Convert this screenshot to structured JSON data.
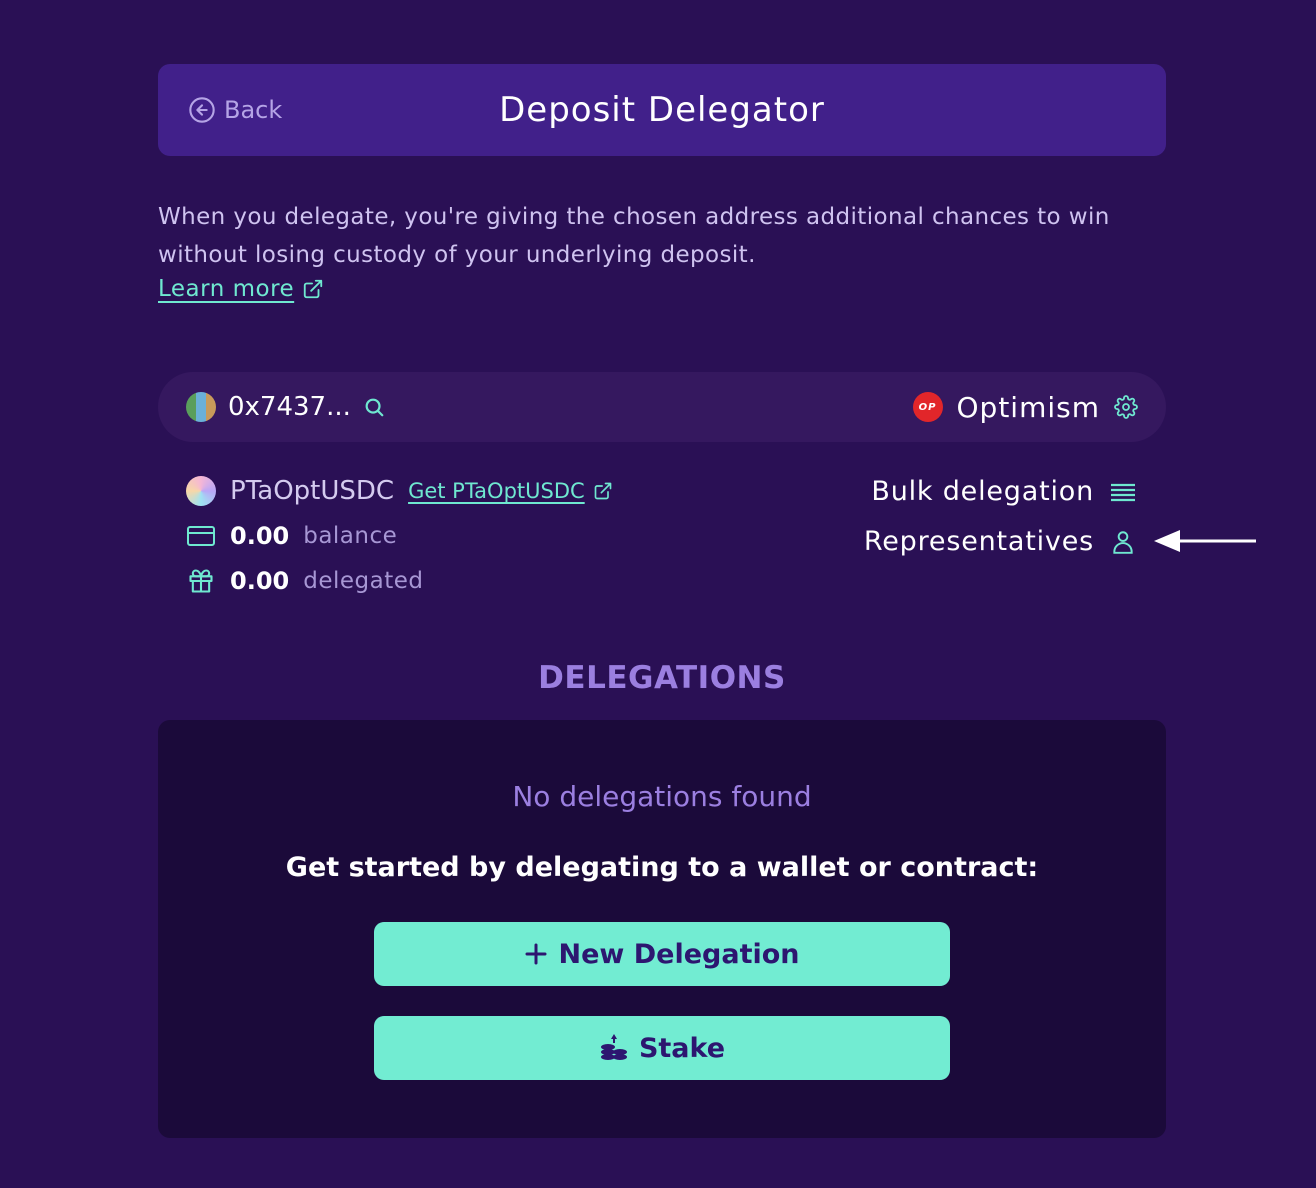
{
  "header": {
    "back_label": "Back",
    "title": "Deposit Delegator"
  },
  "description": {
    "text": "When you delegate, you're giving the chosen address additional chances to win without losing custody of your underlying deposit.",
    "learn_more": "Learn more"
  },
  "selector": {
    "address": "0x7437...",
    "network_badge": "OP",
    "network": "Optimism"
  },
  "token": {
    "name": "PTaOptUSDC",
    "get_link": "Get PTaOptUSDC",
    "balance_value": "0.00",
    "balance_label": "balance",
    "delegated_value": "0.00",
    "delegated_label": "delegated"
  },
  "actions": {
    "bulk": "Bulk delegation",
    "representatives": "Representatives"
  },
  "delegations": {
    "title": "DELEGATIONS",
    "empty": "No delegations found",
    "cta": "Get started by delegating to a wallet or contract:",
    "new_button": "New Delegation",
    "stake_button": "Stake"
  },
  "colors": {
    "background": "#2a1055",
    "header": "#41208a",
    "accent": "#72ecd2",
    "link": "#6fe8d0",
    "section_title": "#9b7fe0",
    "panel": "#1b0a3a"
  },
  "icons": [
    "back-arrow-icon",
    "external-link-icon",
    "search-icon",
    "settings-icon",
    "credit-card-icon",
    "gift-icon",
    "list-icon",
    "user-icon",
    "plus-icon",
    "coins-icon",
    "pointer-arrow-icon"
  ]
}
